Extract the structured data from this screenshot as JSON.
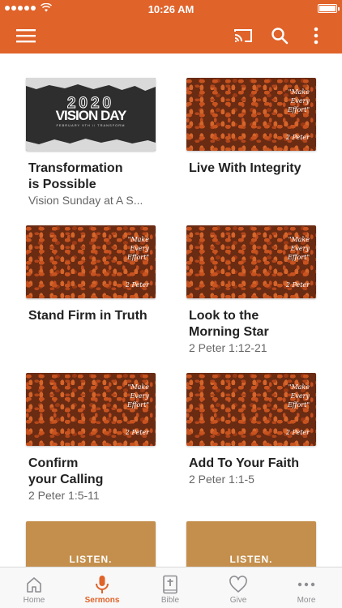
{
  "status_bar": {
    "time": "10:26 AM"
  },
  "colors": {
    "accent": "#e0632a",
    "inactive": "#8e8e93",
    "petal_dark": "#6a2b13",
    "listen_tan": "#c48f4c"
  },
  "app_bar": {
    "icons": [
      "menu-icon",
      "cast-icon",
      "search-icon",
      "more-vertical-icon"
    ]
  },
  "sermons": [
    {
      "title": "Transformation\nis Possible",
      "subtitle": "Vision Sunday at A S...",
      "thumb": "vision",
      "thumb_text": {
        "year": "2020",
        "name": "VISION DAY",
        "caption": "FEBRUARY 9TH // TRANSFORM"
      }
    },
    {
      "title": "Live With Integrity",
      "subtitle": "",
      "thumb": "petals",
      "thumb_text": {
        "verse": "\"Make\nEvery\nEffort\"",
        "book": "2 Peter"
      }
    },
    {
      "title": "Stand Firm in Truth",
      "subtitle": "",
      "thumb": "petals",
      "thumb_text": {
        "verse": "\"Make\nEvery\nEffort\"",
        "book": "2 Peter"
      }
    },
    {
      "title": "Look to the\nMorning Star",
      "subtitle": "2 Peter 1:12-21",
      "thumb": "petals",
      "thumb_text": {
        "verse": "\"Make\nEvery\nEffort\"",
        "book": "2 Peter"
      }
    },
    {
      "title": "Confirm\nyour Calling",
      "subtitle": "2 Peter 1:5-11",
      "thumb": "petals",
      "thumb_text": {
        "verse": "\"Make\nEvery\nEffort\"",
        "book": "2 Peter"
      }
    },
    {
      "title": "Add To Your Faith",
      "subtitle": "2 Peter 1:1-5",
      "thumb": "petals",
      "thumb_text": {
        "verse": "\"Make\nEvery\nEffort\"",
        "book": "2 Peter"
      }
    },
    {
      "title": "",
      "subtitle": "",
      "thumb": "listen",
      "thumb_text": {
        "listen": "LISTEN."
      }
    },
    {
      "title": "",
      "subtitle": "",
      "thumb": "listen",
      "thumb_text": {
        "listen": "LISTEN."
      }
    }
  ],
  "tabs": [
    {
      "label": "Home",
      "icon": "home-icon",
      "active": false
    },
    {
      "label": "Sermons",
      "icon": "microphone-icon",
      "active": true
    },
    {
      "label": "Bible",
      "icon": "bible-icon",
      "active": false
    },
    {
      "label": "Give",
      "icon": "heart-icon",
      "active": false
    },
    {
      "label": "More",
      "icon": "more-horizontal-icon",
      "active": false
    }
  ]
}
